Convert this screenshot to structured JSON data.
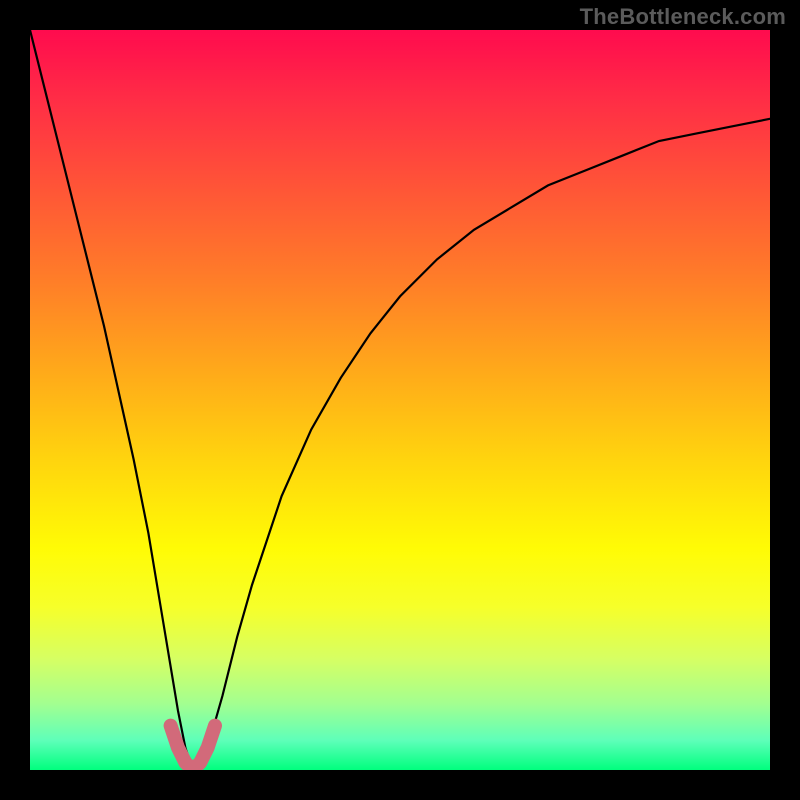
{
  "watermark": {
    "text": "TheBottleneck.com"
  },
  "chart_data": {
    "type": "line",
    "title": "",
    "xlabel": "",
    "ylabel": "",
    "xlim": [
      0,
      100
    ],
    "ylim": [
      0,
      100
    ],
    "grid": false,
    "legend": false,
    "background_gradient": {
      "top_color": "#ff0b4e",
      "bottom_color": "#00ff7e",
      "description": "vertical rainbow gradient red-orange-yellow-green representing bottleneck percentage; red=high, green=low"
    },
    "series": [
      {
        "name": "bottleneck-curve",
        "color": "#000000",
        "x": [
          0,
          2,
          4,
          6,
          8,
          10,
          12,
          14,
          16,
          18,
          20,
          21,
          22,
          23,
          24,
          26,
          28,
          30,
          34,
          38,
          42,
          46,
          50,
          55,
          60,
          65,
          70,
          75,
          80,
          85,
          90,
          95,
          100
        ],
        "values": [
          100,
          92,
          84,
          76,
          68,
          60,
          51,
          42,
          32,
          20,
          8,
          3,
          0,
          0,
          3,
          10,
          18,
          25,
          37,
          46,
          53,
          59,
          64,
          69,
          73,
          76,
          79,
          81,
          83,
          85,
          86,
          87,
          88
        ]
      },
      {
        "name": "optimal-range-marker",
        "color": "#d26a7a",
        "x": [
          19,
          20,
          21,
          22,
          23,
          24,
          25
        ],
        "values": [
          6,
          3,
          1,
          0,
          1,
          3,
          6
        ]
      }
    ],
    "annotations": []
  }
}
